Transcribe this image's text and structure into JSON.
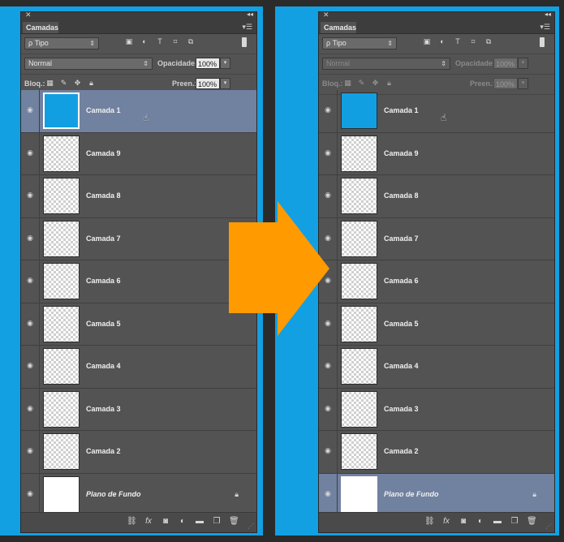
{
  "panel_title": "Camadas",
  "filter": {
    "label": "Tipo",
    "search_glyph": "ρ"
  },
  "blend_mode": "Normal",
  "opacity": {
    "label": "Opacidade:",
    "value": "100%"
  },
  "lock": {
    "label": "Bloq.:"
  },
  "fill": {
    "label": "Preen.:",
    "value": "100%"
  },
  "layers": [
    {
      "name": "Camada 1"
    },
    {
      "name": "Camada 9"
    },
    {
      "name": "Camada 8"
    },
    {
      "name": "Camada 7"
    },
    {
      "name": "Camada 6"
    },
    {
      "name": "Camada 5"
    },
    {
      "name": "Camada 4"
    },
    {
      "name": "Camada 3"
    },
    {
      "name": "Camada 2"
    },
    {
      "name": "Plano de Fundo"
    }
  ],
  "colors": {
    "accent_blue": "#12a0e2",
    "arrow_orange": "#ff9a00",
    "selection": "#7181a0"
  },
  "icons": [
    "eye-icon",
    "lock-icon",
    "link-layers-icon",
    "fx-icon",
    "mask-icon",
    "adjustment-icon",
    "group-folder-icon",
    "new-layer-icon",
    "trash-icon",
    "hand-cursor-icon"
  ]
}
